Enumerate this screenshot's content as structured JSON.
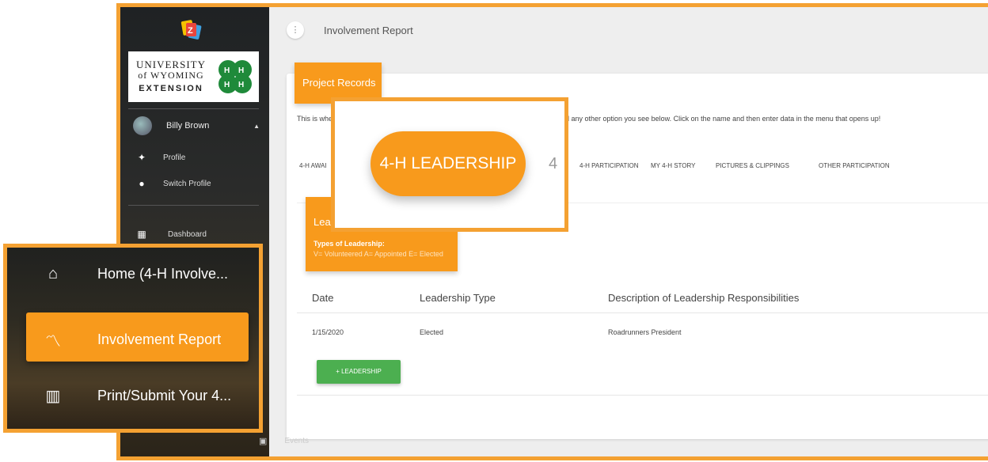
{
  "app": {
    "logo_icon": "zsuite-logo-icon",
    "org_logo": {
      "line1": "UNIVERSITY",
      "line2": "of WYOMING",
      "line3": "EXTENSION",
      "clover_icon": "4h-clover-icon"
    }
  },
  "sidebar": {
    "user_name": "Billy Brown",
    "user_caret": "▲",
    "items": [
      {
        "label": "Profile",
        "icon": "person-icon"
      },
      {
        "label": "Switch Profile",
        "icon": "account-icon"
      },
      {
        "label": "Dashboard",
        "icon": "dashboard-icon"
      },
      {
        "label": "Events",
        "icon": "events-icon"
      }
    ]
  },
  "topbar": {
    "menu_icon": "⋮",
    "title": "Involvement Report"
  },
  "card": {
    "header": "Project Records",
    "intro_left": "This is whe",
    "intro_right": "d any other option you see below. Click on the name and then enter data in the menu that opens up!",
    "tabs": [
      "4-H AWAI",
      "4-H PARTICIPATION",
      "MY 4-H STORY",
      "PICTURES & CLIPPINGS",
      "OTHER PARTICIPATION"
    ]
  },
  "leadership_section": {
    "title": "Lead",
    "subtitle": "Types of Leadership:",
    "legend": "V= Volunteered A= Appointed E= Elected"
  },
  "table": {
    "headers": [
      "Date",
      "Leadership Type",
      "Description of Leadership Responsibilities"
    ],
    "rows": [
      {
        "date": "1/15/2020",
        "type": "Elected",
        "description": "Roadrunners President"
      }
    ]
  },
  "add_button": {
    "label": "+ LEADERSHIP"
  },
  "zoom_pill": {
    "label": "4-H LEADERSHIP",
    "partial": "4"
  },
  "zoom_menu": {
    "items": [
      {
        "label": "Home (4-H Involve...",
        "icon": "home-icon"
      },
      {
        "label": "Involvement Report",
        "icon": "trending-icon",
        "active": true
      },
      {
        "label": "Print/Submit Your 4...",
        "icon": "table-icon"
      }
    ]
  },
  "colors": {
    "accent": "#f89a1c",
    "border": "#f4a132",
    "green": "#4caf50"
  }
}
